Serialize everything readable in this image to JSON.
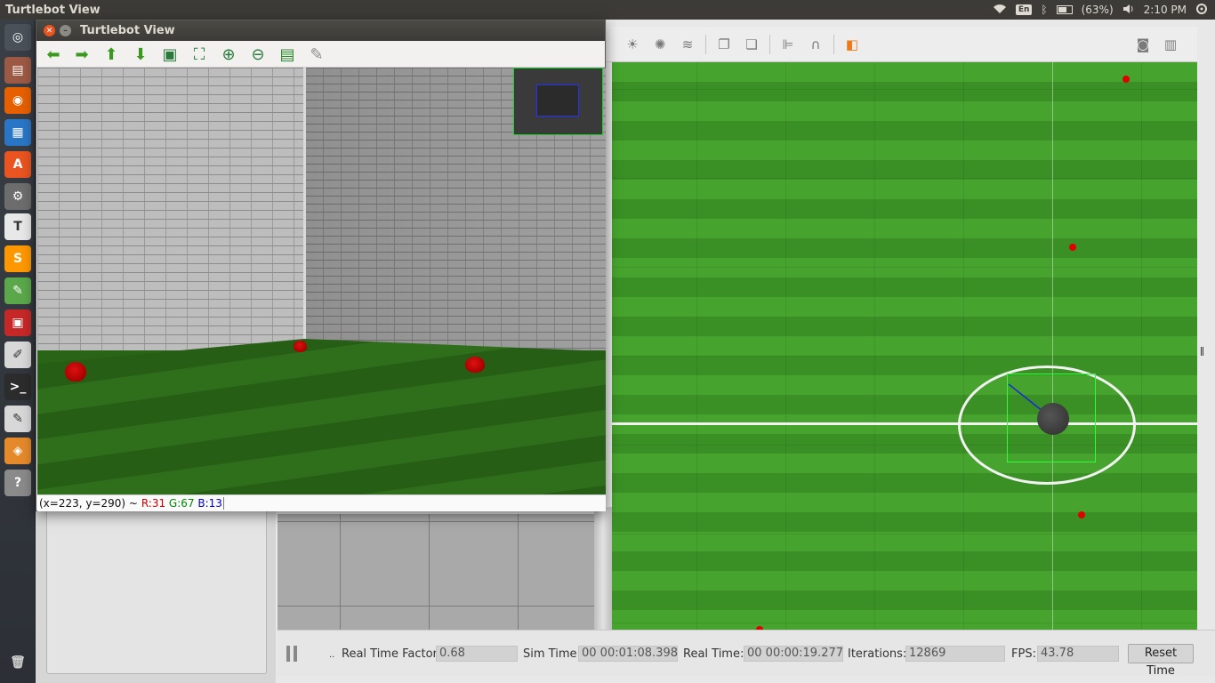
{
  "top_panel": {
    "app_title": "Turtlebot View",
    "keyboard_layout": "En",
    "battery": "(63%)",
    "battery_level": 0.63,
    "clock": "2:10 PM"
  },
  "launcher": {
    "items": [
      {
        "name": "dash-icon",
        "color": "#4a5159",
        "glyph": "◎"
      },
      {
        "name": "files-icon",
        "color": "#9c5a44",
        "glyph": "▤"
      },
      {
        "name": "firefox-icon",
        "color": "#e66000",
        "glyph": "◉"
      },
      {
        "name": "libreoffice-writer-icon",
        "color": "#2a76c6",
        "glyph": "▦"
      },
      {
        "name": "software-center-icon",
        "color": "#e95420",
        "glyph": "A"
      },
      {
        "name": "system-settings-icon",
        "color": "#6d6d6d",
        "glyph": "⚙"
      },
      {
        "name": "tex-editor-icon",
        "color": "#e8e8e8",
        "glyph": "T"
      },
      {
        "name": "sublime-text-icon",
        "color": "#ff9800",
        "glyph": "S"
      },
      {
        "name": "text-editor-icon",
        "color": "#5aa84a",
        "glyph": "✎"
      },
      {
        "name": "pdf-viewer-icon",
        "color": "#c62828",
        "glyph": "▣"
      },
      {
        "name": "gedit-icon",
        "color": "#d8d8d8",
        "glyph": "✐"
      },
      {
        "name": "terminal-icon",
        "color": "#2c2c2c",
        "glyph": ">_"
      },
      {
        "name": "notes-icon",
        "color": "#d8d8d8",
        "glyph": "✎"
      },
      {
        "name": "gazebo-icon",
        "color": "#e58a2b",
        "glyph": "◈"
      },
      {
        "name": "help-icon",
        "color": "#8a8a8a",
        "glyph": "?"
      }
    ],
    "trash": {
      "name": "trash-icon",
      "glyph": "🗑"
    }
  },
  "turtlebot_view": {
    "title": "Turtlebot View",
    "toolbar": [
      {
        "name": "back-arrow-icon",
        "glyph": "⬅",
        "color": "#3a9a1e"
      },
      {
        "name": "forward-arrow-icon",
        "glyph": "➡",
        "color": "#3a9a1e"
      },
      {
        "name": "up-arrow-icon",
        "glyph": "⬆",
        "color": "#3a9a1e"
      },
      {
        "name": "down-arrow-icon",
        "glyph": "⬇",
        "color": "#3a9a1e"
      },
      {
        "name": "image-icon",
        "glyph": "▣",
        "color": "#2a7a3a"
      },
      {
        "name": "zoom-fit-icon",
        "glyph": "⛶",
        "color": "#2a7a3a"
      },
      {
        "name": "zoom-in-icon",
        "glyph": "⊕",
        "color": "#2a7a3a"
      },
      {
        "name": "zoom-out-icon",
        "glyph": "⊖",
        "color": "#2a7a3a"
      },
      {
        "name": "save-icon",
        "glyph": "▤",
        "color": "#2a8a2a"
      },
      {
        "name": "brush-icon",
        "glyph": "✎",
        "color": "#8a8a8a"
      }
    ],
    "status": {
      "coords": "(x=223, y=290) ~",
      "r": "R:31",
      "g": "G:67",
      "b": "B:13"
    }
  },
  "gazebo": {
    "toolbar": [
      {
        "name": "sun-light-icon",
        "glyph": "☀"
      },
      {
        "name": "point-light-icon",
        "glyph": "✺"
      },
      {
        "name": "directional-light-icon",
        "glyph": "≋"
      },
      {
        "name": "copy-icon",
        "glyph": "❐"
      },
      {
        "name": "paste-icon",
        "glyph": "❏"
      },
      {
        "name": "align-icon",
        "glyph": "⊫"
      },
      {
        "name": "snap-icon",
        "glyph": "∩"
      },
      {
        "name": "view-angle-icon",
        "glyph": "◧"
      },
      {
        "name": "screenshot-icon",
        "glyph": "◙"
      },
      {
        "name": "log-icon",
        "glyph": "▥"
      }
    ],
    "status_bar": {
      "real_time_factor_label": "Real Time Factor:",
      "real_time_factor": "0.68",
      "sim_time_label": "Sim Time:",
      "sim_time": "00 00:01:08.398",
      "real_time_label": "Real Time:",
      "real_time": "00 00:00:19.277",
      "iterations_label": "Iterations:",
      "iterations": "12869",
      "fps_label": "FPS:",
      "fps": "43.78",
      "reset_label": "Reset Time",
      "step_marker": ".."
    }
  }
}
